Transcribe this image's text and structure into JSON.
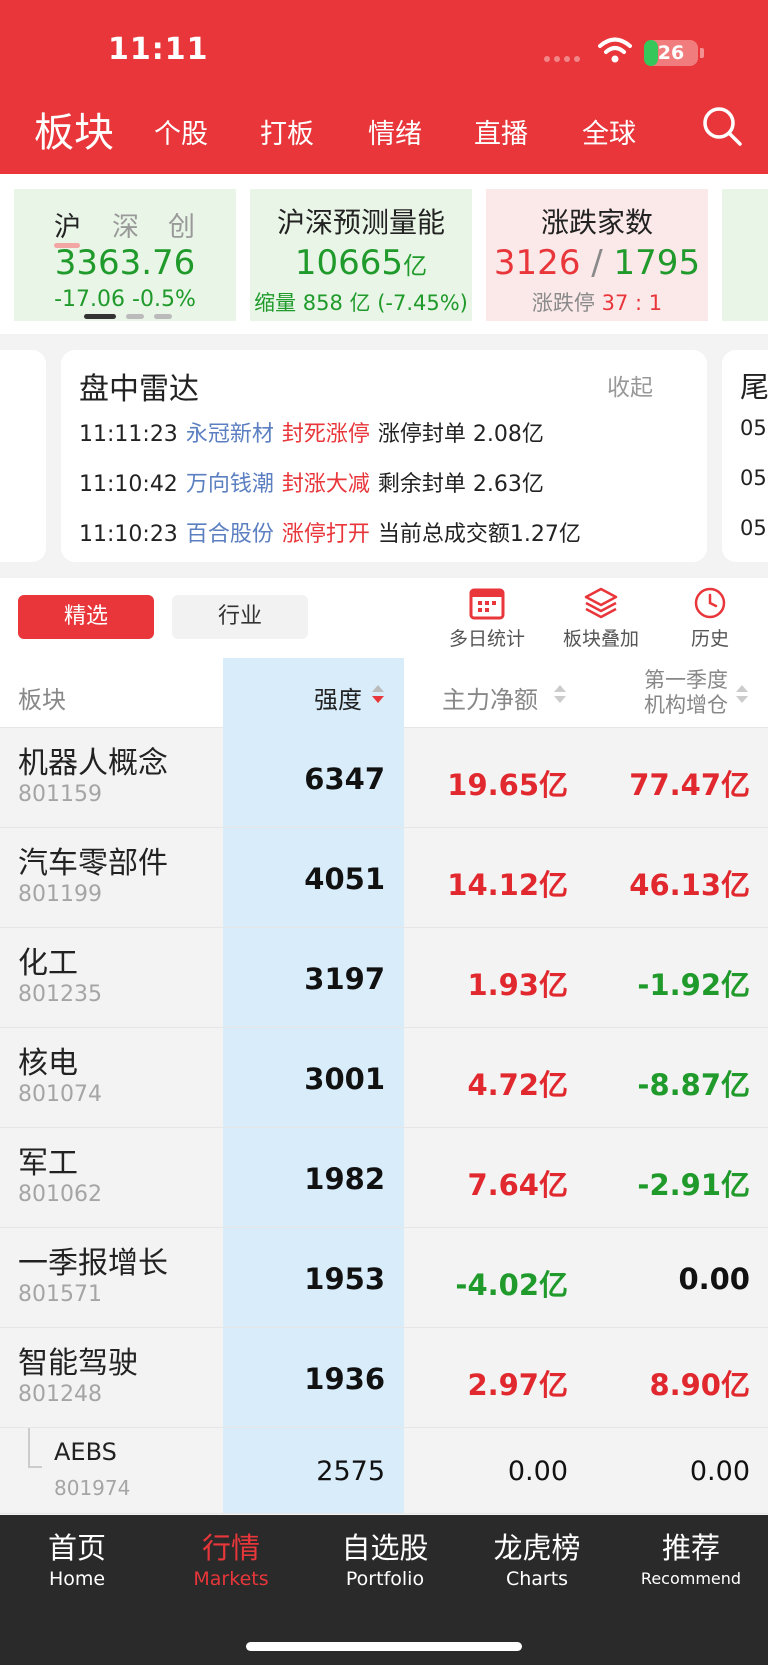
{
  "status_bar": {
    "time": "11:11",
    "battery": "26",
    "battery_level": 0.26
  },
  "header": {
    "title": "板块",
    "tabs": [
      "个股",
      "打板",
      "情绪",
      "直播",
      "全球"
    ]
  },
  "index_card": {
    "tabs": [
      "沪",
      "深",
      "创"
    ],
    "value": "3363.76",
    "change": "-17.06",
    "change_pct": "-0.5%"
  },
  "volume_card": {
    "title": "沪深预测量能",
    "value": "10665",
    "unit": "亿",
    "sub": "缩量 858 亿 (-7.45%)"
  },
  "breadth_card": {
    "title": "涨跌家数",
    "up": "3126",
    "sep": "/",
    "down": "1795",
    "limit_label": "涨跌停",
    "limit_value": "37 : 1"
  },
  "radar": {
    "title": "盘中雷达",
    "collapse_label": "收起",
    "items": [
      {
        "time": "11:11:23",
        "stock": "永冠新材",
        "event": "封死涨停",
        "detail": "涨停封单 2.08亿"
      },
      {
        "time": "11:10:42",
        "stock": "万向钱潮",
        "event": "封涨大减",
        "detail": "剩余封单 2.63亿"
      },
      {
        "time": "11:10:23",
        "stock": "百合股份",
        "event": "涨停打开",
        "detail": "当前总成交额1.27亿"
      }
    ],
    "side_card": {
      "title": "尾",
      "rows": [
        "05",
        "05",
        "05"
      ]
    }
  },
  "toolbar": {
    "segments": [
      "精选",
      "行业"
    ],
    "tools": [
      "多日统计",
      "板块叠加",
      "历史"
    ]
  },
  "table": {
    "headers": {
      "sector": "板块",
      "strength": "强度",
      "net_flow": "主力净额",
      "inst_line1": "第一季度",
      "inst_line2": "机构增仓"
    },
    "rows": [
      {
        "name": "机器人概念",
        "code": "801159",
        "strength": "6347",
        "net": "19.65亿",
        "inst": "77.47亿"
      },
      {
        "name": "汽车零部件",
        "code": "801199",
        "strength": "4051",
        "net": "14.12亿",
        "inst": "46.13亿"
      },
      {
        "name": "化工",
        "code": "801235",
        "strength": "3197",
        "net": "1.93亿",
        "inst": "-1.92亿"
      },
      {
        "name": "核电",
        "code": "801074",
        "strength": "3001",
        "net": "4.72亿",
        "inst": "-8.87亿"
      },
      {
        "name": "军工",
        "code": "801062",
        "strength": "1982",
        "net": "7.64亿",
        "inst": "-2.91亿"
      },
      {
        "name": "一季报增长",
        "code": "801571",
        "strength": "1953",
        "net": "-4.02亿",
        "inst": "0.00"
      },
      {
        "name": "智能驾驶",
        "code": "801248",
        "strength": "1936",
        "net": "2.97亿",
        "inst": "8.90亿"
      },
      {
        "name": "AEBS",
        "code": "801974",
        "strength": "2575",
        "net": "0.00",
        "inst": "0.00"
      }
    ]
  },
  "tabbar": {
    "items": [
      {
        "zh": "首页",
        "en": "Home"
      },
      {
        "zh": "行情",
        "en": "Markets"
      },
      {
        "zh": "自选股",
        "en": "Portfolio"
      },
      {
        "zh": "龙虎榜",
        "en": "Charts"
      },
      {
        "zh": "推荐",
        "en": "Recommend"
      }
    ]
  },
  "colors": {
    "brand_red": "#e8363a",
    "up_red": "#e0282e",
    "down_green": "#1f9a2b",
    "highlight_blue": "#d8ecfa",
    "tabbar_bg": "#2a2a2a"
  }
}
